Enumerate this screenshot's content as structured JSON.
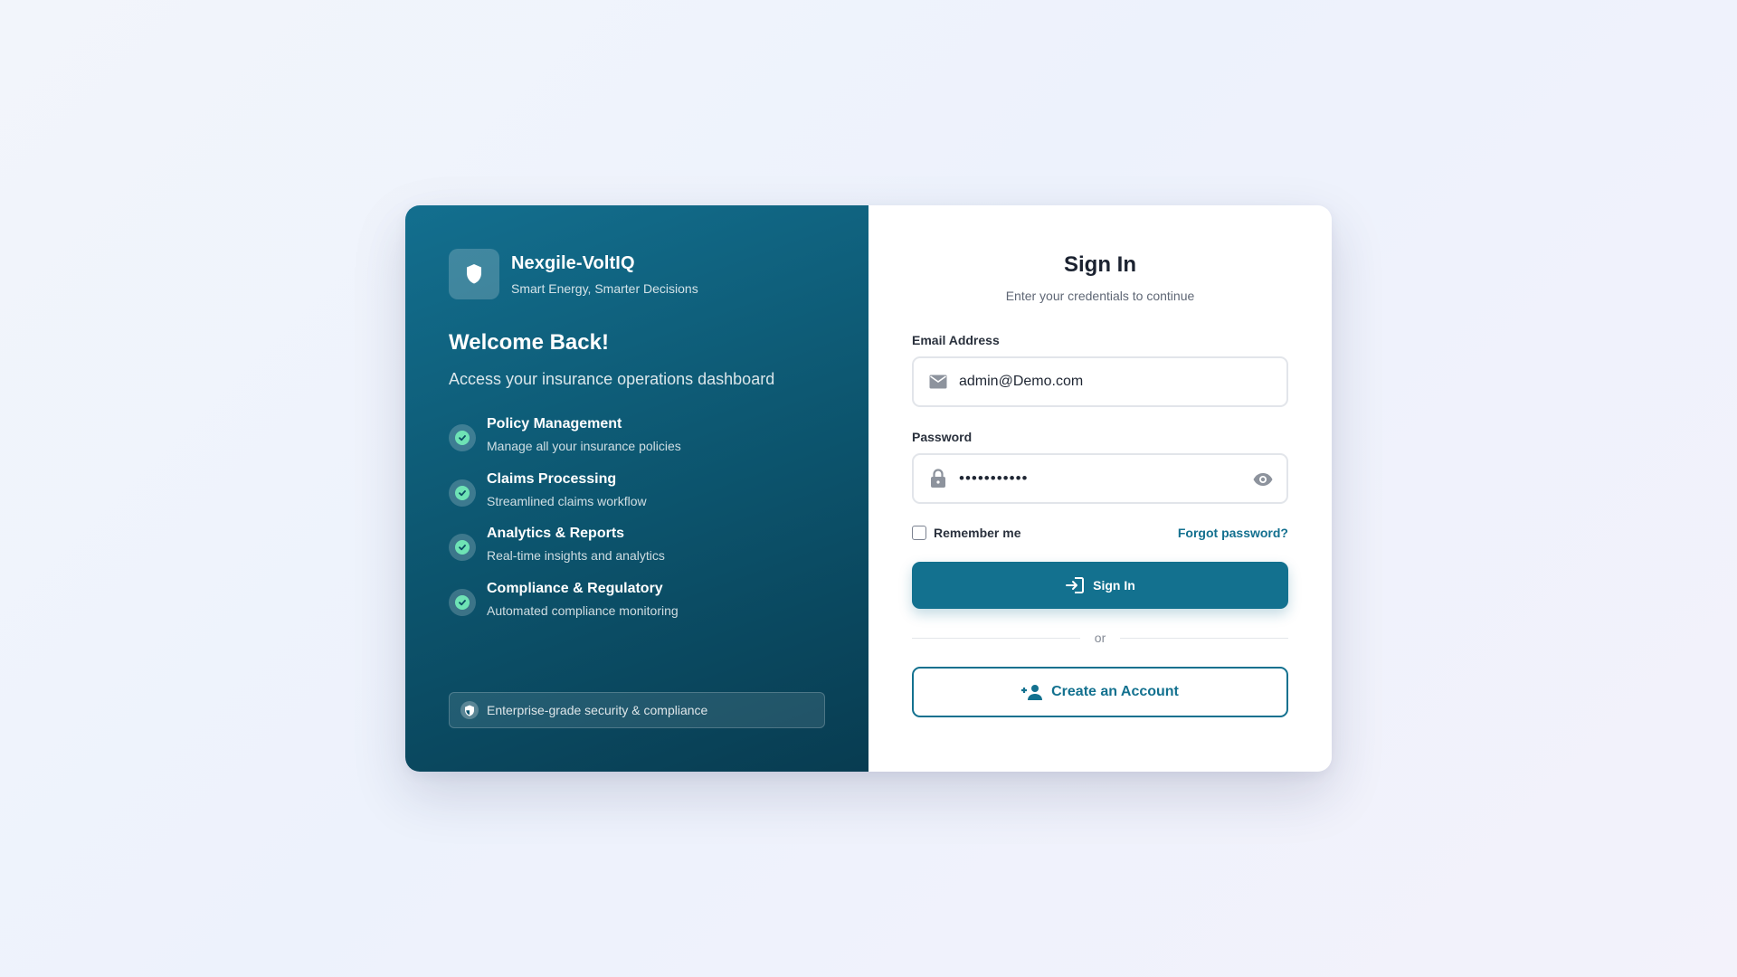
{
  "brand": {
    "name": "Nexgile-VoltIQ",
    "tagline": "Smart Energy, Smarter Decisions",
    "logo_icon": "shield-icon"
  },
  "welcome": {
    "title": "Welcome Back!",
    "subtitle": "Access your insurance operations dashboard"
  },
  "features": [
    {
      "title": "Policy Management",
      "description": "Manage all your insurance policies"
    },
    {
      "title": "Claims Processing",
      "description": "Streamlined claims workflow"
    },
    {
      "title": "Analytics & Reports",
      "description": "Real-time insights and analytics"
    },
    {
      "title": "Compliance & Regulatory",
      "description": "Automated compliance monitoring"
    }
  ],
  "security_note": "Enterprise-grade security & compliance",
  "form": {
    "title": "Sign In",
    "subtitle": "Enter your credentials to continue",
    "email_label": "Email Address",
    "email_value": "admin@Demo.com",
    "password_label": "Password",
    "password_value": "•••••••••••",
    "remember_label": "Remember me",
    "remember_checked": false,
    "forgot_label": "Forgot password?",
    "signin_label": "Sign In",
    "divider_label": "or",
    "create_label": "Create an Account"
  },
  "colors": {
    "primary": "#13718f",
    "panel_dark": "#083c51",
    "check_green": "#6ee3b5",
    "background": "#eef2fb"
  }
}
